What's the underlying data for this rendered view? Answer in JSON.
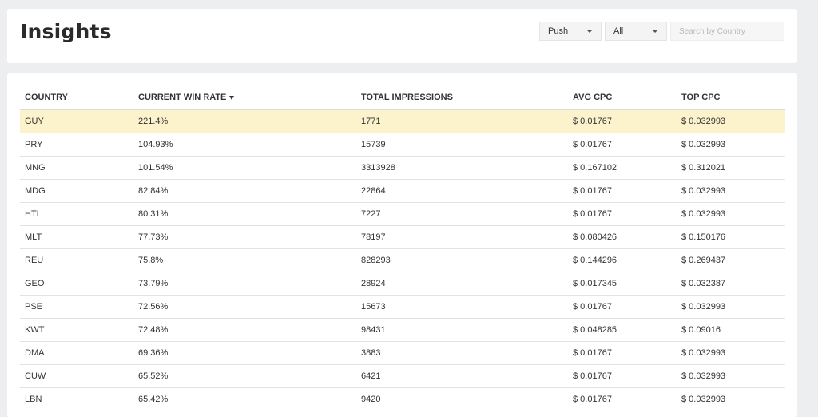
{
  "header": {
    "title": "Insights",
    "filters": {
      "type_select": "Push",
      "scope_select": "All",
      "search_placeholder": "Search by Country",
      "search_value": ""
    }
  },
  "table": {
    "columns": [
      "COUNTRY",
      "CURRENT WIN RATE",
      "TOTAL IMPRESSIONS",
      "AVG CPC",
      "TOP CPC"
    ],
    "sorted_column": "CURRENT WIN RATE",
    "sort_direction": "desc",
    "highlight_color": "#fcf2cb",
    "rows": [
      [
        "GUY",
        "221.4%",
        "1771",
        "$ 0.01767",
        "$ 0.032993"
      ],
      [
        "PRY",
        "104.93%",
        "15739",
        "$ 0.01767",
        "$ 0.032993"
      ],
      [
        "MNG",
        "101.54%",
        "3313928",
        "$ 0.167102",
        "$ 0.312021"
      ],
      [
        "MDG",
        "82.84%",
        "22864",
        "$ 0.01767",
        "$ 0.032993"
      ],
      [
        "HTI",
        "80.31%",
        "7227",
        "$ 0.01767",
        "$ 0.032993"
      ],
      [
        "MLT",
        "77.73%",
        "78197",
        "$ 0.080426",
        "$ 0.150176"
      ],
      [
        "REU",
        "75.8%",
        "828293",
        "$ 0.144296",
        "$ 0.269437"
      ],
      [
        "GEO",
        "73.79%",
        "28924",
        "$ 0.017345",
        "$ 0.032387"
      ],
      [
        "PSE",
        "72.56%",
        "15673",
        "$ 0.01767",
        "$ 0.032993"
      ],
      [
        "KWT",
        "72.48%",
        "98431",
        "$ 0.048285",
        "$ 0.09016"
      ],
      [
        "DMA",
        "69.36%",
        "3883",
        "$ 0.01767",
        "$ 0.032993"
      ],
      [
        "CUW",
        "65.52%",
        "6421",
        "$ 0.01767",
        "$ 0.032993"
      ],
      [
        "LBN",
        "65.42%",
        "9420",
        "$ 0.01767",
        "$ 0.032993"
      ]
    ]
  }
}
